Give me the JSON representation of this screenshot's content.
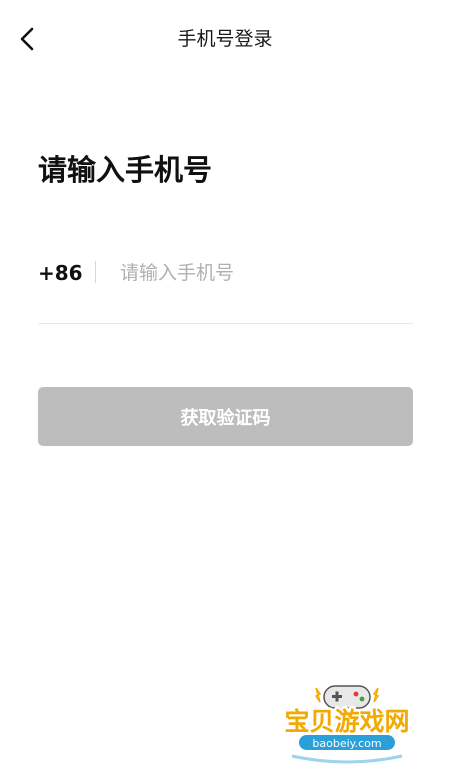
{
  "nav": {
    "back_icon": "chevron-left-icon",
    "title": "手机号登录"
  },
  "login": {
    "heading": "请输入手机号",
    "country_code": "+86",
    "phone_placeholder": "请输入手机号",
    "phone_value": "",
    "submit_label": "获取验证码",
    "submit_color": "#bdbdbd"
  },
  "watermark": {
    "name": "宝贝游戏网",
    "url": "baobeiy.com",
    "icon": "gamepad-icon",
    "colors": {
      "name": "#f2a900",
      "url_bg": "#2a9fd8"
    }
  }
}
